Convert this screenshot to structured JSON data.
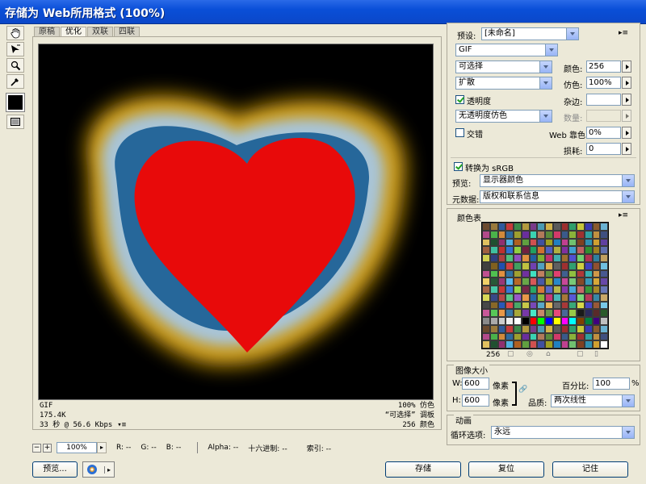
{
  "window": {
    "title": "存储为 Web所用格式 (100%)"
  },
  "tabs": [
    "原稿",
    "优化",
    "双联",
    "四联"
  ],
  "tabs_active": 1,
  "tools": [
    "hand-icon",
    "slice-select-icon",
    "zoom-icon",
    "eyedropper-icon"
  ],
  "image_info": {
    "format": "GIF",
    "size": "175.4K",
    "time": "33 秒 @ 56.6 Kbps",
    "dither": "100% 仿色",
    "palette": "“可选择” 调板",
    "colors": "256 颜色"
  },
  "statusbar": {
    "zoom": "100%",
    "r": "R: --",
    "g": "G: --",
    "b": "B: --",
    "alpha": "Alpha: --",
    "hex": "十六进制: --",
    "index": "索引: --"
  },
  "settings": {
    "preset_label": "预设:",
    "preset": "[未命名]",
    "format": "GIF",
    "reduction": "可选择",
    "dither_algo": "扩散",
    "transparency_label": "透明度",
    "transparency_checked": true,
    "transparency_dither": "无透明度仿色",
    "interlace_label": "交错",
    "interlace_checked": false,
    "colors_label": "颜色:",
    "colors": "256",
    "dither_label": "仿色:",
    "dither": "100%",
    "matte_label": "杂边:",
    "matte": "",
    "amount_label": "数量:",
    "amount": "",
    "websnap_label": "Web 靠色:",
    "websnap": "0%",
    "lossy_label": "损耗:",
    "lossy": "0",
    "srgb_label": "转换为 sRGB",
    "srgb_checked": true,
    "preview_label": "预览:",
    "preview": "显示器颜色",
    "metadata_label": "元数据:",
    "metadata": "版权和联系信息"
  },
  "color_table": {
    "title": "颜色表",
    "count": "256",
    "colors": [
      "#6b4a2e",
      "#9a7a3c",
      "#2f5a9e",
      "#c83a3a",
      "#3a8a4a",
      "#b29a3e",
      "#7a3a8a",
      "#4a9ab2",
      "#d2b24a",
      "#5a5a5a",
      "#9e2e2e",
      "#2e9e6a",
      "#c8c83a",
      "#3a3ab2",
      "#8a5a2e",
      "#6ab2d2",
      "#b24a8a",
      "#4ab24a",
      "#d28a3a",
      "#2e6a9e",
      "#9e9e2e",
      "#6a2e9e",
      "#3ad2b2",
      "#b27a5a",
      "#5a8a3a",
      "#d23a6a",
      "#3a5a8a",
      "#8ab23a",
      "#a03030",
      "#30a0a0",
      "#c09040",
      "#405080",
      "#e0c060",
      "#205030",
      "#903070",
      "#50b0e0",
      "#b06020",
      "#60a040",
      "#d05050",
      "#4050a0",
      "#a0a020",
      "#2080c0",
      "#c04090",
      "#70c070",
      "#804020",
      "#3090b0",
      "#d0a030",
      "#6040a0",
      "#a06040",
      "#40c0a0",
      "#c03030",
      "#3070d0",
      "#90d040",
      "#702040",
      "#20a060",
      "#d07030",
      "#5060c0",
      "#b0b040",
      "#8030a0",
      "#40a0d0",
      "#c06060",
      "#309030",
      "#a08020",
      "#6070b0",
      "#d0d050",
      "#304080",
      "#b04040",
      "#50c080",
      "#9050c0",
      "#e09040",
      "#2060a0",
      "#80b030",
      "#c03070",
      "#40b0b0",
      "#a07030",
      "#5050d0",
      "#70d070",
      "#b03050",
      "#3080a0",
      "#c0a060",
      "#404040",
      "#806020",
      "#2050b0",
      "#d04040",
      "#40a060",
      "#c0c040",
      "#7040b0",
      "#50a0c0",
      "#e0b050",
      "#606060",
      "#a03030",
      "#30a070",
      "#d0d040",
      "#4040c0",
      "#905030",
      "#70c0e0",
      "#c05090",
      "#50c050",
      "#e09040",
      "#3070a0",
      "#a0a030",
      "#7030a0",
      "#40e0c0",
      "#c08060",
      "#609040",
      "#e04070",
      "#406090",
      "#90c040",
      "#b03838",
      "#38b0b0",
      "#d09848",
      "#485890",
      "#f0d068",
      "#285838",
      "#983878",
      "#58b8f0",
      "#b86828",
      "#68a848",
      "#d85858",
      "#4858a8",
      "#a8a828",
      "#2888c8",
      "#c84898",
      "#78c878",
      "#884828",
      "#3898b8",
      "#d8a838",
      "#6848a8",
      "#a86848",
      "#48c8a8",
      "#c83838",
      "#3878d8",
      "#98d848",
      "#782848",
      "#28a868",
      "#d87838",
      "#5868c8",
      "#b8b848",
      "#8838a8",
      "#48a8d8",
      "#c86868",
      "#389838",
      "#a88828",
      "#6878b8",
      "#d8d858",
      "#384888",
      "#b84848",
      "#58c888",
      "#9858c8",
      "#e89848",
      "#2868a8",
      "#88b838",
      "#c83878",
      "#48b8b8",
      "#a87838",
      "#5858d8",
      "#78d878",
      "#b83858",
      "#3888a8",
      "#c8a868",
      "#484848",
      "#886828",
      "#2858b8",
      "#d84848",
      "#48a868",
      "#c8c848",
      "#7848b8",
      "#58a8c8",
      "#e8b858",
      "#686868",
      "#a83838",
      "#38a878",
      "#d8d848",
      "#4848c8",
      "#985838",
      "#78c8e8",
      "#c85898",
      "#58c858",
      "#e89848",
      "#3878a8",
      "#a8a838",
      "#7838a8",
      "#48e8c8",
      "#c88868",
      "#689848",
      "#e84878",
      "#486898",
      "#98c848",
      "#1a1a1a",
      "#2a2a5a",
      "#5a2a2a",
      "#2a5a2a",
      "#8a8a8a",
      "#aaaaaa",
      "#cccccc",
      "#eeeeee",
      "#ffffff",
      "#000000",
      "#ff0000",
      "#00ff00",
      "#0000ff",
      "#ffff00",
      "#ff00ff",
      "#00ffff",
      "#804000",
      "#008040",
      "#400080",
      "#c0c0c0",
      "#6b4a2e",
      "#9a7a3c",
      "#2f5a9e",
      "#c83a3a",
      "#3a8a4a",
      "#b29a3e",
      "#7a3a8a",
      "#4a9ab2",
      "#d2b24a",
      "#5a5a5a",
      "#9e2e2e",
      "#2e9e6a",
      "#c8c83a",
      "#3a3ab2",
      "#8a5a2e",
      "#6ab2d2",
      "#b24a8a",
      "#4ab24a",
      "#d28a3a",
      "#2e6a9e",
      "#9e9e2e",
      "#6a2e9e",
      "#3ad2b2",
      "#b27a5a",
      "#5a8a3a",
      "#d23a6a",
      "#3a5a8a",
      "#8ab23a",
      "#a03030",
      "#30a0a0",
      "#c09040",
      "#405080",
      "#e0c060",
      "#205030",
      "#903070",
      "#50b0e0",
      "#b06020",
      "#60a040",
      "#d05050",
      "#4050a0",
      "#a0a020",
      "#2080c0",
      "#c04090",
      "#70c070",
      "#804020",
      "#3090b0",
      "#d0a030",
      "#ffffff"
    ]
  },
  "image_size": {
    "title": "图像大小",
    "w_label": "W:",
    "w": "600",
    "h_label": "H:",
    "h": "600",
    "unit": "像素",
    "percent_label": "百分比:",
    "percent": "100",
    "percent_unit": "%",
    "quality_label": "品质:",
    "quality": "两次线性"
  },
  "animation": {
    "title": "动画",
    "loop_label": "循环选项:",
    "loop": "永远"
  },
  "buttons": {
    "preview": "预览...",
    "save": "存储",
    "reset": "复位",
    "remember": "记住"
  },
  "colors": {
    "heart": "#e80a0a",
    "blue": "#26679a",
    "glow": "#b8860b",
    "title_bar": "#0a4fd8"
  }
}
